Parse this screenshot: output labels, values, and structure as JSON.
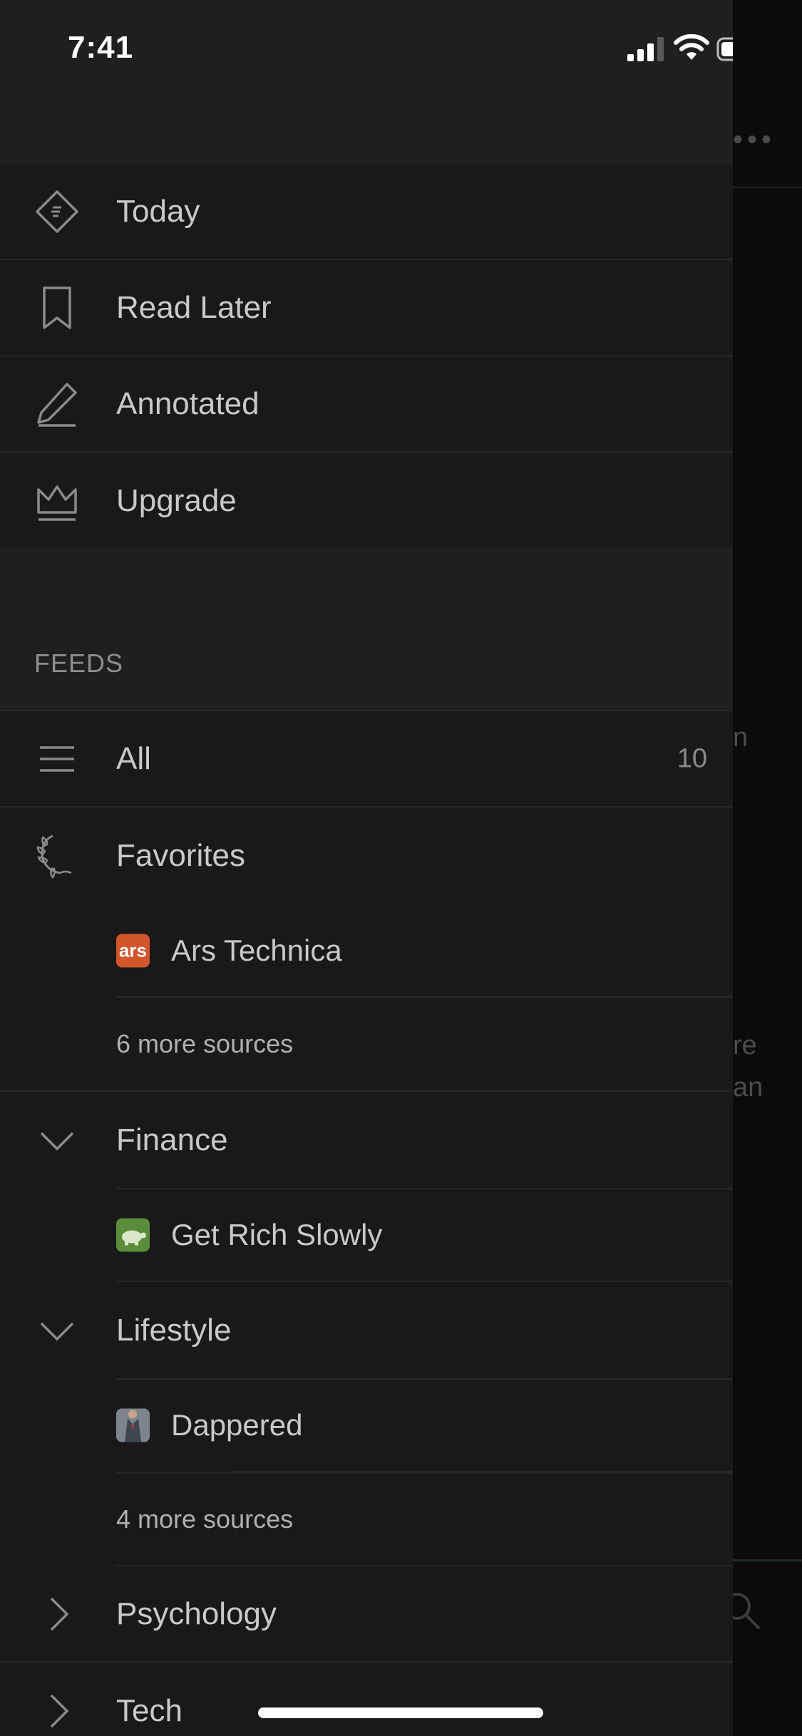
{
  "status_bar": {
    "time": "7:41"
  },
  "nav": {
    "items": [
      {
        "label": "Today",
        "icon": "today-tag-icon"
      },
      {
        "label": "Read Later",
        "icon": "bookmark-icon"
      },
      {
        "label": "Annotated",
        "icon": "pencil-icon"
      },
      {
        "label": "Upgrade",
        "icon": "crown-icon"
      }
    ]
  },
  "feeds": {
    "heading": "FEEDS",
    "all": {
      "label": "All",
      "count": "10"
    },
    "favorites": {
      "label": "Favorites",
      "source": "Ars Technica",
      "favicon_text": "ars",
      "more": "6 more sources"
    },
    "finance": {
      "label": "Finance",
      "source": "Get Rich Slowly"
    },
    "lifestyle": {
      "label": "Lifestyle",
      "source": "Dappered",
      "more": "4 more sources"
    },
    "psychology": {
      "label": "Psychology"
    },
    "tech": {
      "label": "Tech"
    }
  },
  "background_fragments": {
    "line1": "n",
    "line2": "re",
    "line3": "an"
  },
  "colors": {
    "drawer_bg": "#1f1f1f",
    "row_bg": "#191919",
    "text": "#c9c9c9",
    "muted": "#8e8e8e",
    "ars_brand": "#d2552b",
    "grs_brand": "#5a8c3a"
  }
}
